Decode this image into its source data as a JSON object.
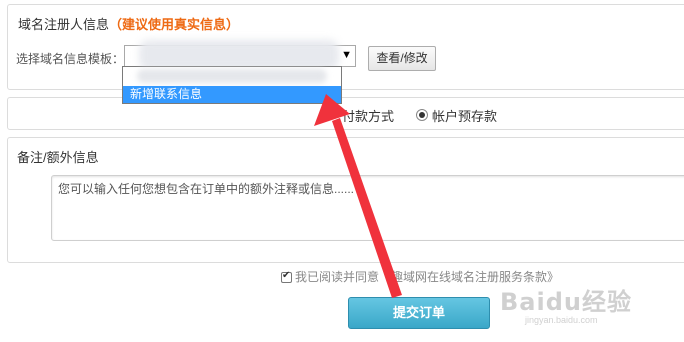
{
  "registrant": {
    "title": "域名注册人信息",
    "hint": "（建议使用真实信息）",
    "template_label": "选择域名信息模板：",
    "view_edit_button": "查看/修改",
    "dropdown_new_option": "新增联系信息"
  },
  "payment": {
    "label": "付款方式",
    "option": "帐户预存款"
  },
  "remark": {
    "title": "备注/额外信息",
    "placeholder": "您可以输入任何您想包含在订单中的额外注释或信息......"
  },
  "agreement": {
    "text": "我已阅读并同意《趣域网在线域名注册服务条款》"
  },
  "submit": {
    "label": "提交订单"
  },
  "colors": {
    "hint_orange": "#ee6a14",
    "dropdown_highlight": "#3399ff",
    "submit_blue": "#45b0d0",
    "annotation_red": "#f0323c"
  },
  "watermark": {
    "logo": "Baidu经验",
    "url": "jingyan.baidu.com"
  }
}
